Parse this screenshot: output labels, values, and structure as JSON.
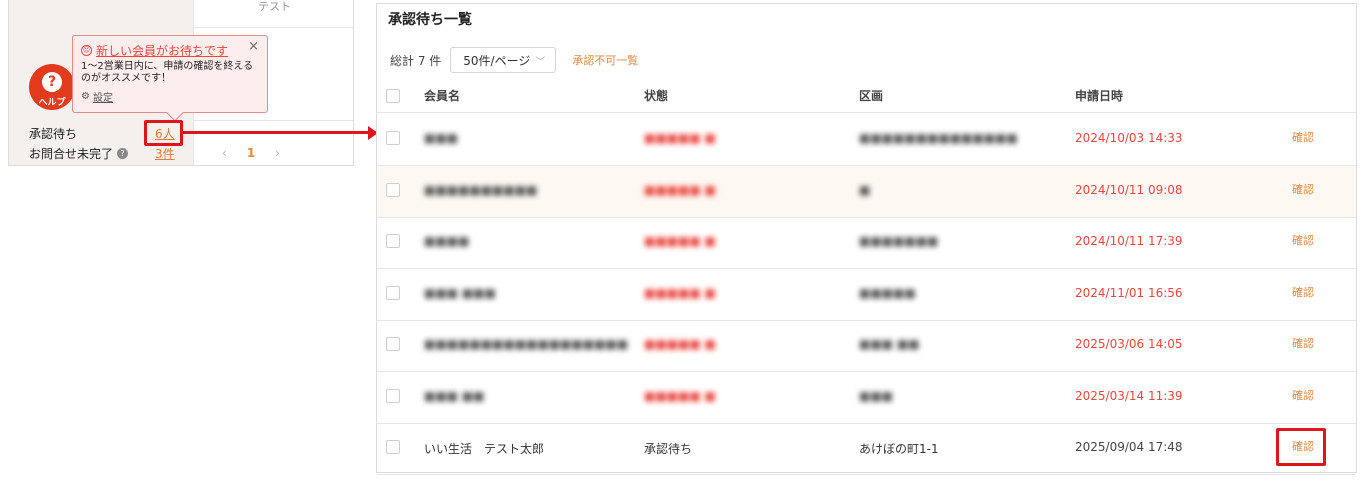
{
  "left": {
    "column_header": "テスト",
    "help_label": "ヘルプ",
    "popup": {
      "title": "新しい会員がお待ちです",
      "body": "1〜2営業日内に、申請の確認を終えるのがオススメです！",
      "settings": "設定",
      "close": "×"
    },
    "stats": {
      "pending_label": "承認待ち",
      "pending_value": "6人",
      "inquiry_label": "お問合せ未完了",
      "inquiry_value": "3件"
    },
    "pager": {
      "prev": "‹",
      "current": "1",
      "next": "›"
    }
  },
  "main": {
    "title": "承認待ち一覧",
    "total": "総計 7 件",
    "per_page": "50件/ページ",
    "reject_link": "承認不可一覧",
    "columns": [
      "会員名",
      "状態",
      "区画",
      "申請日時"
    ],
    "rows": [
      {
        "name": "■■■",
        "status": "■■■■■ ■",
        "area": "■■■■■■■■■■■■■■",
        "date": "2024/10/03 14:33",
        "action": "確認",
        "blurred": true,
        "overdue": true
      },
      {
        "name": "■■■■■■■■■■",
        "status": "■■■■■ ■",
        "area": "■",
        "date": "2024/10/11 09:08",
        "action": "確認",
        "blurred": true,
        "overdue": true
      },
      {
        "name": "■■■■",
        "status": "■■■■■ ■",
        "area": "■■■■■■■",
        "date": "2024/10/11 17:39",
        "action": "確認",
        "blurred": true,
        "overdue": true
      },
      {
        "name": "■■■ ■■■",
        "status": "■■■■■ ■",
        "area": "■■■■■",
        "date": "2024/11/01 16:56",
        "action": "確認",
        "blurred": true,
        "overdue": true
      },
      {
        "name": "■■■■■■■■■■■■■■■■■■",
        "status": "■■■■■ ■",
        "area": "■■■ ■■",
        "date": "2025/03/06 14:05",
        "action": "確認",
        "blurred": true,
        "overdue": true
      },
      {
        "name": "■■■ ■■",
        "status": "■■■■■ ■",
        "area": "■■■",
        "date": "2025/03/14 11:39",
        "action": "確認",
        "blurred": true,
        "overdue": true
      },
      {
        "name": "いい生活　テスト太郎",
        "status": "承認待ち",
        "area": "あけぼの町1-1",
        "date": "2025/09/04 17:48",
        "action": "確認",
        "blurred": false,
        "overdue": false
      }
    ]
  },
  "colors": {
    "accent": "#e6883c",
    "alert": "#e8463f",
    "highlight": "#e0141e"
  }
}
